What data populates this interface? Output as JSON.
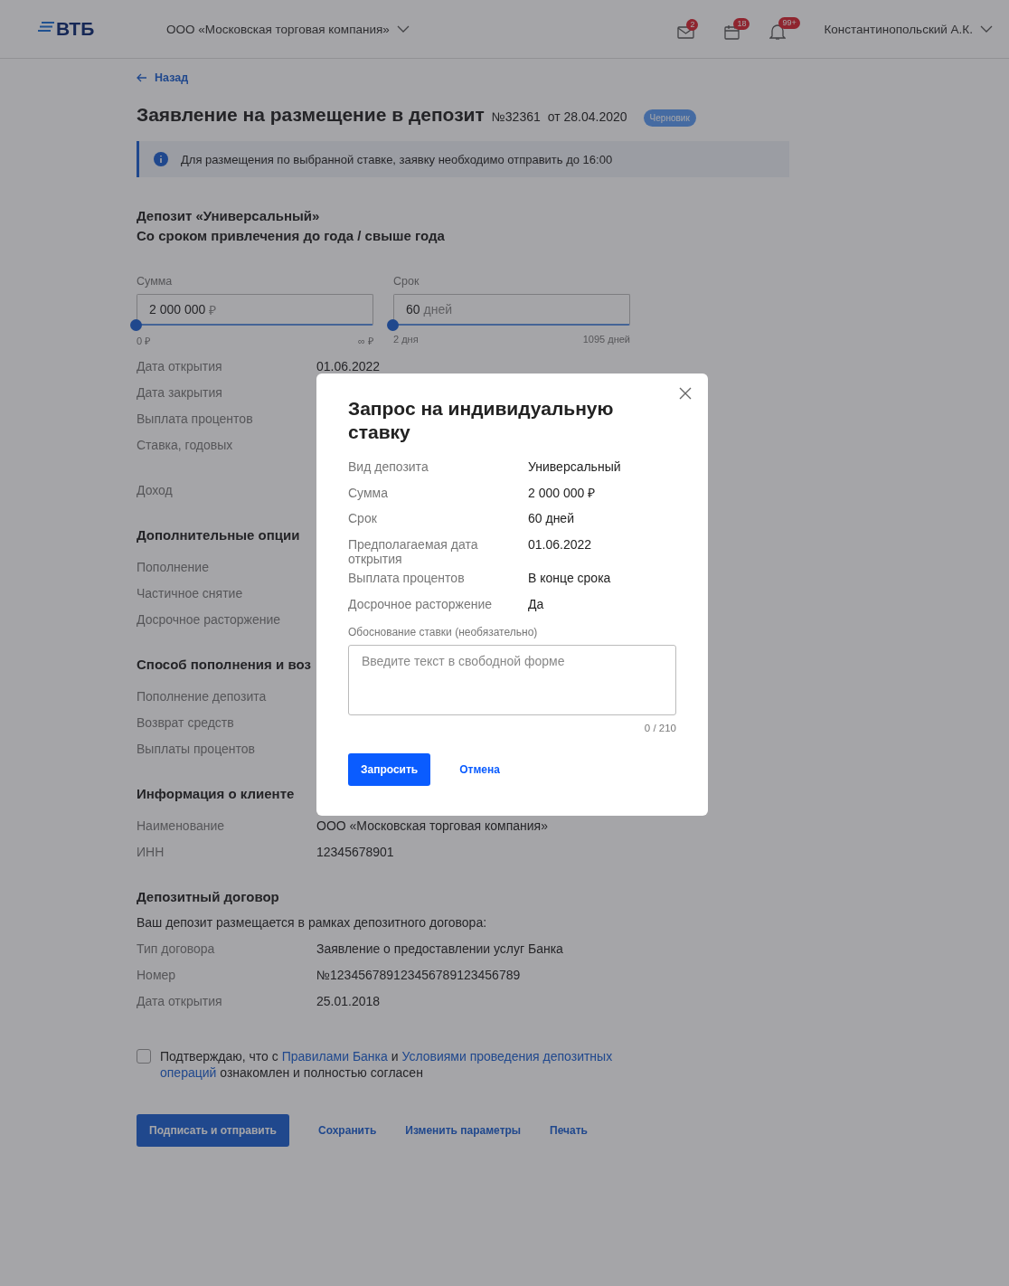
{
  "header": {
    "logo": "ВТБ",
    "company": "ООО «Московская торговая компания»",
    "notifications": [
      {
        "kind": "mail",
        "count": "2"
      },
      {
        "kind": "calendar",
        "count": "18"
      },
      {
        "kind": "bell",
        "count": "99+"
      }
    ],
    "user": "Константинопольский А.К."
  },
  "back": "Назад",
  "title": {
    "text": "Заявление на размещение в депозит",
    "number": "№32361",
    "date": "от 28.04.2020",
    "status": "Черновик"
  },
  "info_banner": "Для размещения по выбранной ставке, заявку необходимо отправить до 16:00",
  "deposit": {
    "name": "Депозит «Универсальный»",
    "subtitle": "Со сроком привлечения до года / свыше года"
  },
  "sliders": [
    {
      "label": "Сумма",
      "value": "2 000 000",
      "unit": "₽",
      "min": "0 ₽",
      "max": "∞ ₽",
      "level": 0
    },
    {
      "label": "Срок",
      "value": "60",
      "unit": "дней",
      "min": "2 дня",
      "max": "1095 дней",
      "level": 0
    }
  ],
  "params": [
    {
      "label": "Дата открытия",
      "value": "01.06.2022"
    },
    {
      "label": "Дата закрытия"
    },
    {
      "label": "Выплата процентов"
    },
    {
      "label": "Ставка, годовых"
    },
    {
      "label": "Доход"
    }
  ],
  "sections": [
    {
      "title": "Дополнительные опции",
      "rows": [
        {
          "label": "Пополнение"
        },
        {
          "label": "Частичное снятие"
        },
        {
          "label": "Досрочное расторжение"
        }
      ]
    },
    {
      "title": "Способ пополнения и воз",
      "rows": [
        {
          "label": "Пополнение депозита"
        },
        {
          "label": "Возврат средств"
        },
        {
          "label": "Выплаты процентов"
        }
      ]
    },
    {
      "title": "Информация о клиенте",
      "rows": [
        {
          "label": "Наименование",
          "value": "ООО «Московская торговая компания»"
        },
        {
          "label": "ИНН",
          "value": "12345678901"
        }
      ]
    },
    {
      "title": "Депозитный договор",
      "note": "Ваш депозит размещается в рамках депозитного договора:",
      "rows": [
        {
          "label": "Тип договора",
          "value": "Заявление о предоставлении услуг Банка"
        },
        {
          "label": "Номер",
          "value": "№123456789123456789123456789"
        },
        {
          "label": "Дата открытия",
          "value": "25.01.2018"
        }
      ]
    }
  ],
  "consent": {
    "checked": false,
    "parts": [
      {
        "kind": "text",
        "text": "Подтверждаю, что с"
      },
      {
        "kind": "link",
        "text": "Правилами Банка"
      },
      {
        "kind": "text",
        "text": "и"
      },
      {
        "kind": "link",
        "text": "Условиями проведения депозитных"
      },
      {
        "kind": "link",
        "text": "операций"
      },
      {
        "kind": "text",
        "text": "ознакомлен и полностью согласен"
      }
    ]
  },
  "actions": [
    {
      "kind": "primary",
      "label": "Подписать и отправить"
    },
    {
      "kind": "link",
      "label": "Сохранить"
    },
    {
      "kind": "link",
      "label": "Изменить параметры"
    },
    {
      "kind": "link",
      "label": "Печать"
    }
  ],
  "modal": {
    "title": "Запрос на индивидуальную ставку",
    "rows": [
      {
        "label": "Вид депозита",
        "value": "Универсальный"
      },
      {
        "label": "Сумма",
        "value": "2 000 000 ₽"
      },
      {
        "label": "Срок",
        "value": "60 дней"
      },
      {
        "label": "Предполагаемая дата открытия",
        "value": "01.06.2022"
      },
      {
        "label": "Выплата процентов",
        "value": "В конце срока"
      },
      {
        "label": "Досрочное расторжение",
        "value": "Да"
      }
    ],
    "field": {
      "label": "Обоснование ставки (необязательно)",
      "placeholder": "Введите текст в свободной форме",
      "counter": "0 / 210"
    },
    "buttons": [
      {
        "kind": "primary",
        "label": "Запросить"
      },
      {
        "kind": "link",
        "label": "Отмена"
      }
    ]
  }
}
